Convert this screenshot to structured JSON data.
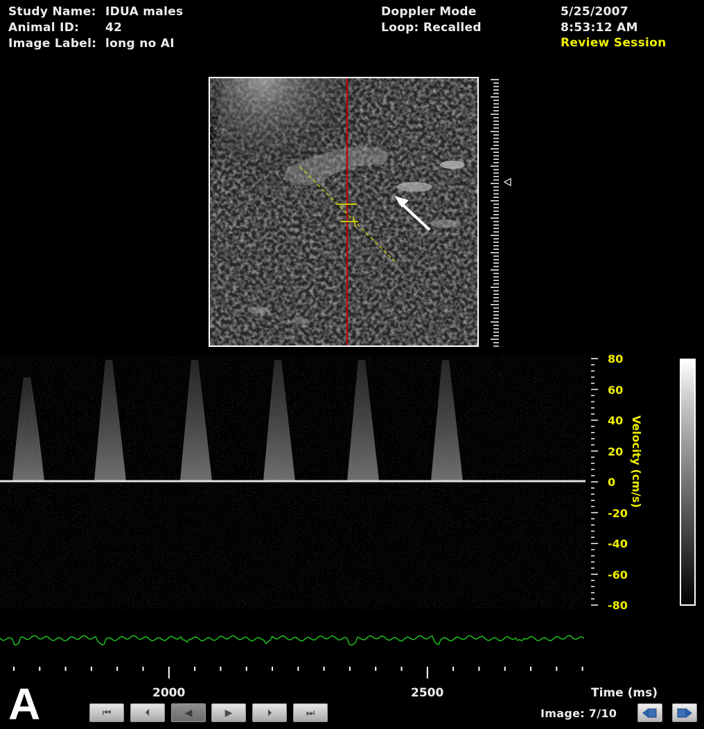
{
  "header": {
    "study_name_label": "Study Name:",
    "study_name_value": "IDUA males",
    "animal_id_label": "Animal ID:",
    "animal_id_value": "42",
    "image_label_label": "Image Label:",
    "image_label_value": "long no AI",
    "mode": "Doppler Mode",
    "loop_status": "Loop: Recalled",
    "date": "5/25/2007",
    "time": "8:53:12 AM",
    "session": "Review Session"
  },
  "velocity_axis": {
    "title": "Velocity (cm/s)",
    "ticks": [
      "80",
      "60",
      "40",
      "20",
      "0",
      "-20",
      "-40",
      "-60",
      "-80"
    ]
  },
  "time_axis": {
    "title": "Time (ms)",
    "ticks": [
      "2000",
      "2500"
    ]
  },
  "panel_letter": "A",
  "playback": {
    "buttons": [
      {
        "name": "first-frame-button",
        "glyph": "⏮"
      },
      {
        "name": "previous-frame-button",
        "glyph": "⏴"
      },
      {
        "name": "rewind-button",
        "glyph": "◀"
      },
      {
        "name": "play-button",
        "glyph": "▶"
      },
      {
        "name": "next-frame-button",
        "glyph": "⏵"
      },
      {
        "name": "last-frame-button",
        "glyph": "⏭"
      }
    ],
    "image_counter": "Image: 7/10"
  },
  "colors": {
    "header_highlight": "#f0f000",
    "cursor_line": "#c00000",
    "ecg_trace": "#20c020",
    "sample_gate": "#c8c800"
  },
  "icons": {
    "export_left": "arrow-left-export-icon",
    "export_right": "arrow-right-export-icon",
    "depth_marker": "triangle-marker-icon"
  }
}
